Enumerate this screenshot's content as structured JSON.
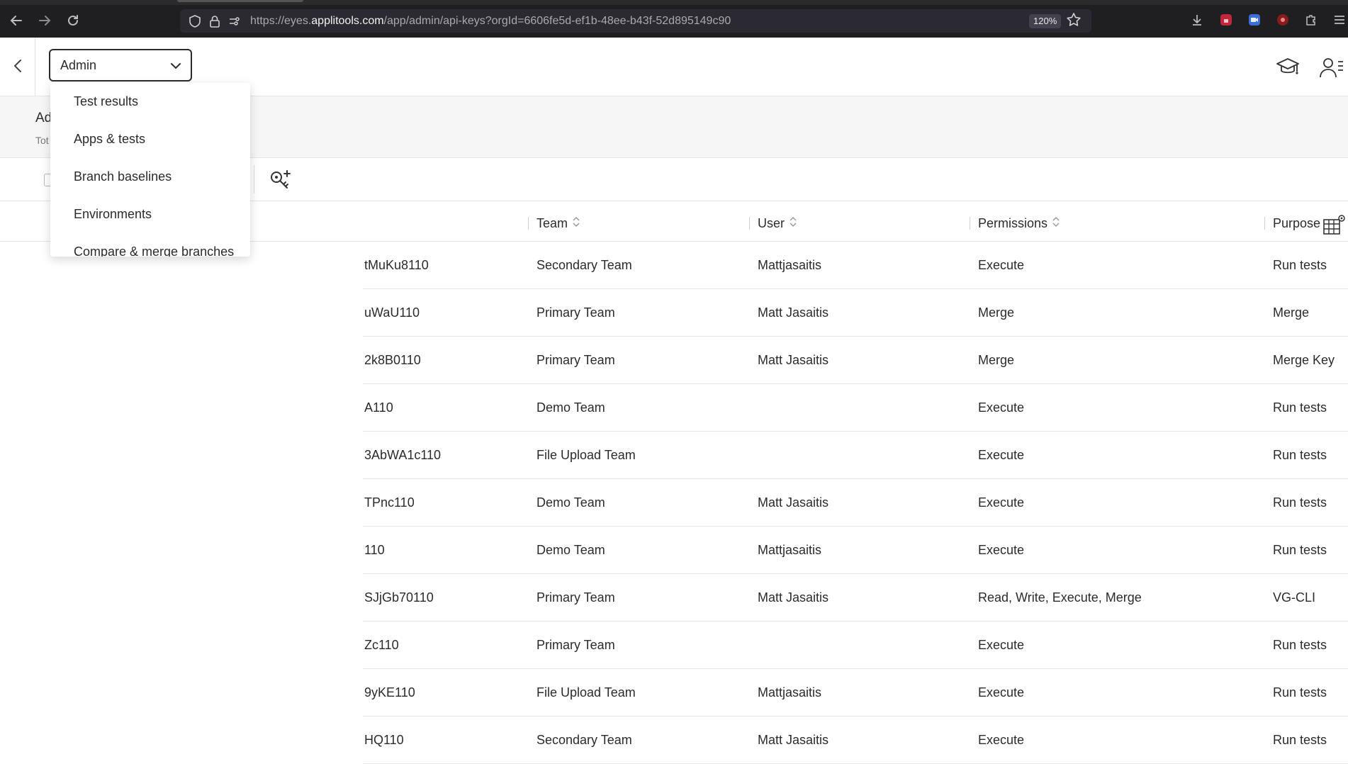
{
  "browser": {
    "url_prefix": "https://eyes.",
    "url_host": "applitools.com",
    "url_path": "/app/admin/api-keys?orgId=6606fe5d-ef1b-48ee-b43f-52d895149c90",
    "zoom": "120%"
  },
  "header": {
    "section_select": "Admin"
  },
  "page": {
    "title": "Ad",
    "subtitle": "Tot"
  },
  "dropdown": {
    "items": [
      {
        "label": "Test results"
      },
      {
        "label": "Apps & tests"
      },
      {
        "label": "Branch baselines"
      },
      {
        "label": "Environments"
      },
      {
        "label": "Compare & merge branches"
      }
    ]
  },
  "table": {
    "columns": {
      "team": "Team",
      "user": "User",
      "permissions": "Permissions",
      "purpose": "Purpose"
    },
    "rows": [
      {
        "key": "tMuKu8110",
        "team": "Secondary Team",
        "user": "Mattjasaitis",
        "permissions": "Execute",
        "purpose": "Run tests"
      },
      {
        "key": "uWaU110",
        "team": "Primary Team",
        "user": "Matt Jasaitis",
        "permissions": "Merge",
        "purpose": "Merge"
      },
      {
        "key": "2k8B0110",
        "team": "Primary Team",
        "user": "Matt Jasaitis",
        "permissions": "Merge",
        "purpose": "Merge Key"
      },
      {
        "key": "A110",
        "team": "Demo Team",
        "user": "",
        "permissions": "Execute",
        "purpose": "Run tests"
      },
      {
        "key": "3AbWA1c110",
        "team": "File Upload Team",
        "user": "",
        "permissions": "Execute",
        "purpose": "Run tests"
      },
      {
        "key": "TPnc110",
        "team": "Demo Team",
        "user": "Matt Jasaitis",
        "permissions": "Execute",
        "purpose": "Run tests"
      },
      {
        "key": "110",
        "team": "Demo Team",
        "user": "Mattjasaitis",
        "permissions": "Execute",
        "purpose": "Run tests"
      },
      {
        "key": "SJjGb70110",
        "team": "Primary Team",
        "user": "Matt Jasaitis",
        "permissions": "Read, Write, Execute, Merge",
        "purpose": "VG-CLI"
      },
      {
        "key": "Zc110",
        "team": "Primary Team",
        "user": "",
        "permissions": "Execute",
        "purpose": "Run tests"
      },
      {
        "key": "9yKE110",
        "team": "File Upload Team",
        "user": "Mattjasaitis",
        "permissions": "Execute",
        "purpose": "Run tests"
      },
      {
        "key": "HQ110",
        "team": "Secondary Team",
        "user": "Matt Jasaitis",
        "permissions": "Execute",
        "purpose": "Run tests"
      }
    ]
  }
}
